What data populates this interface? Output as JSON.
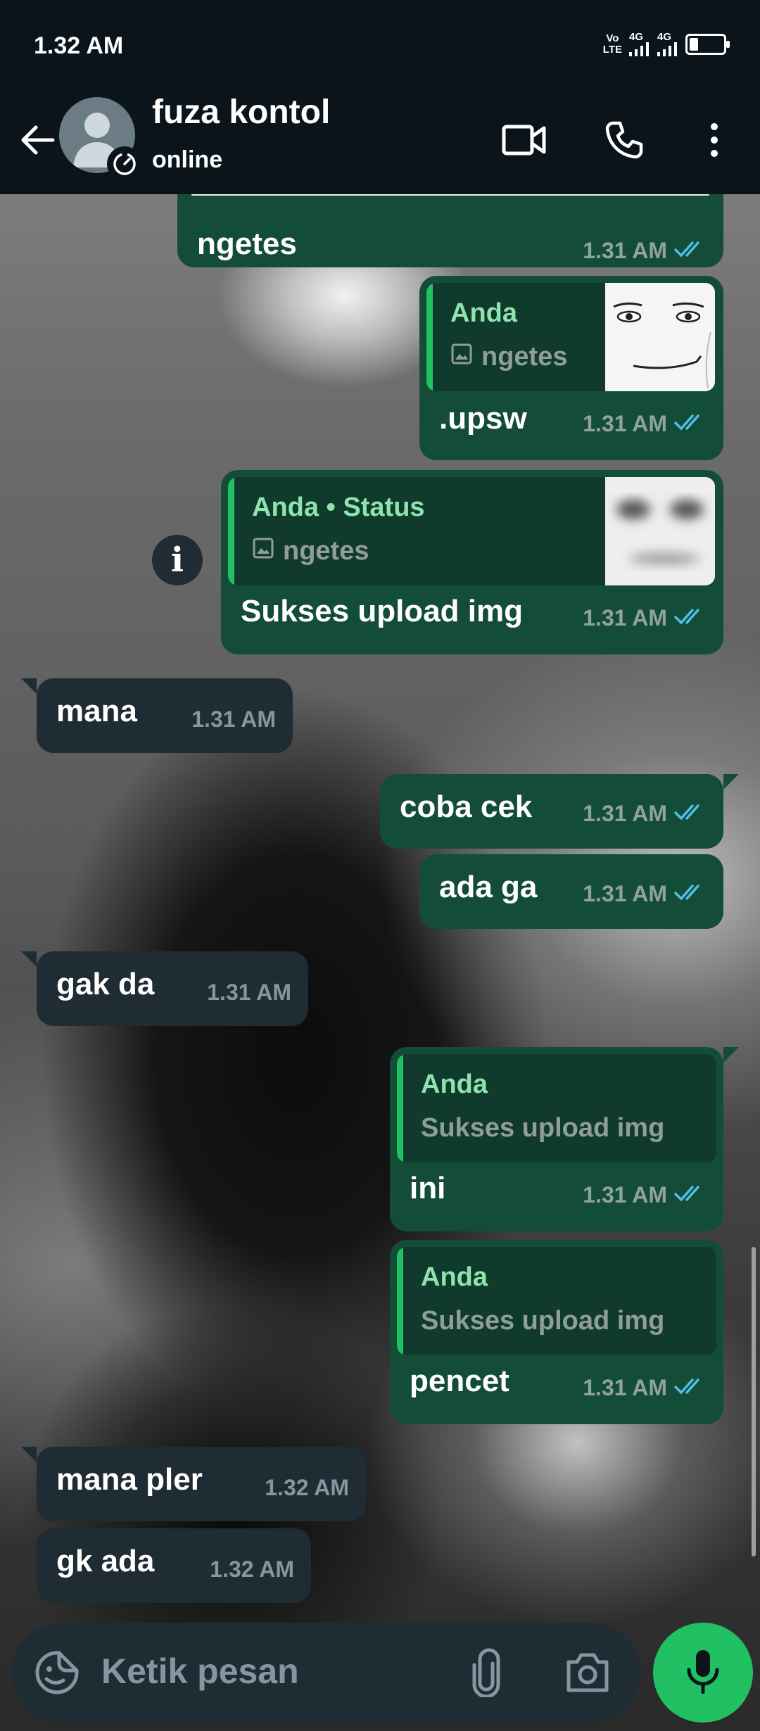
{
  "status_bar": {
    "time": "1.32 AM",
    "volte_top": "Vo",
    "volte_bottom": "LTE",
    "signal_1": "4G",
    "signal_2": "4G",
    "battery_level": 0.2
  },
  "header": {
    "contact_name": "fuza kontol",
    "contact_status": "online",
    "icons": [
      "back-arrow-icon",
      "video-call-icon",
      "phone-icon",
      "more-options-icon"
    ]
  },
  "messages": [
    {
      "dir": "out",
      "text": "ngetes",
      "time": "1.31 AM",
      "status": "read"
    },
    {
      "dir": "out",
      "quote_author": "Anda",
      "quote_text": "ngetes",
      "quote_has_image": true,
      "text": ".upsw",
      "time": "1.31 AM",
      "status": "read"
    },
    {
      "dir": "out",
      "quote_author": "Anda • Status",
      "quote_text": "ngetes",
      "quote_has_image": true,
      "text": "Sukses upload img",
      "time": "1.31 AM",
      "status": "read"
    },
    {
      "dir": "in",
      "text": "mana",
      "time": "1.31 AM"
    },
    {
      "dir": "out",
      "text": "coba cek",
      "time": "1.31 AM",
      "status": "read"
    },
    {
      "dir": "out",
      "text": "ada ga",
      "time": "1.31 AM",
      "status": "read"
    },
    {
      "dir": "in",
      "text": "gak da",
      "time": "1.31 AM"
    },
    {
      "dir": "out",
      "quote_author": "Anda",
      "quote_text": "Sukses upload img",
      "text": "ini",
      "time": "1.31 AM",
      "status": "read"
    },
    {
      "dir": "out",
      "quote_author": "Anda",
      "quote_text": "Sukses upload img",
      "text": "pencet",
      "time": "1.31 AM",
      "status": "read"
    },
    {
      "dir": "in",
      "text": "mana pler",
      "time": "1.32 AM"
    },
    {
      "dir": "in",
      "text": "gk ada",
      "time": "1.32 AM"
    }
  ],
  "composer": {
    "placeholder": "Ketik pesan",
    "icons": [
      "sticker-icon",
      "attach-icon",
      "camera-icon",
      "mic-icon"
    ]
  },
  "colors": {
    "outgoing_bubble": "#144d37",
    "incoming_bubble": "#1f2c33",
    "accent": "#21c063",
    "read_ticks": "#53bdeb"
  }
}
